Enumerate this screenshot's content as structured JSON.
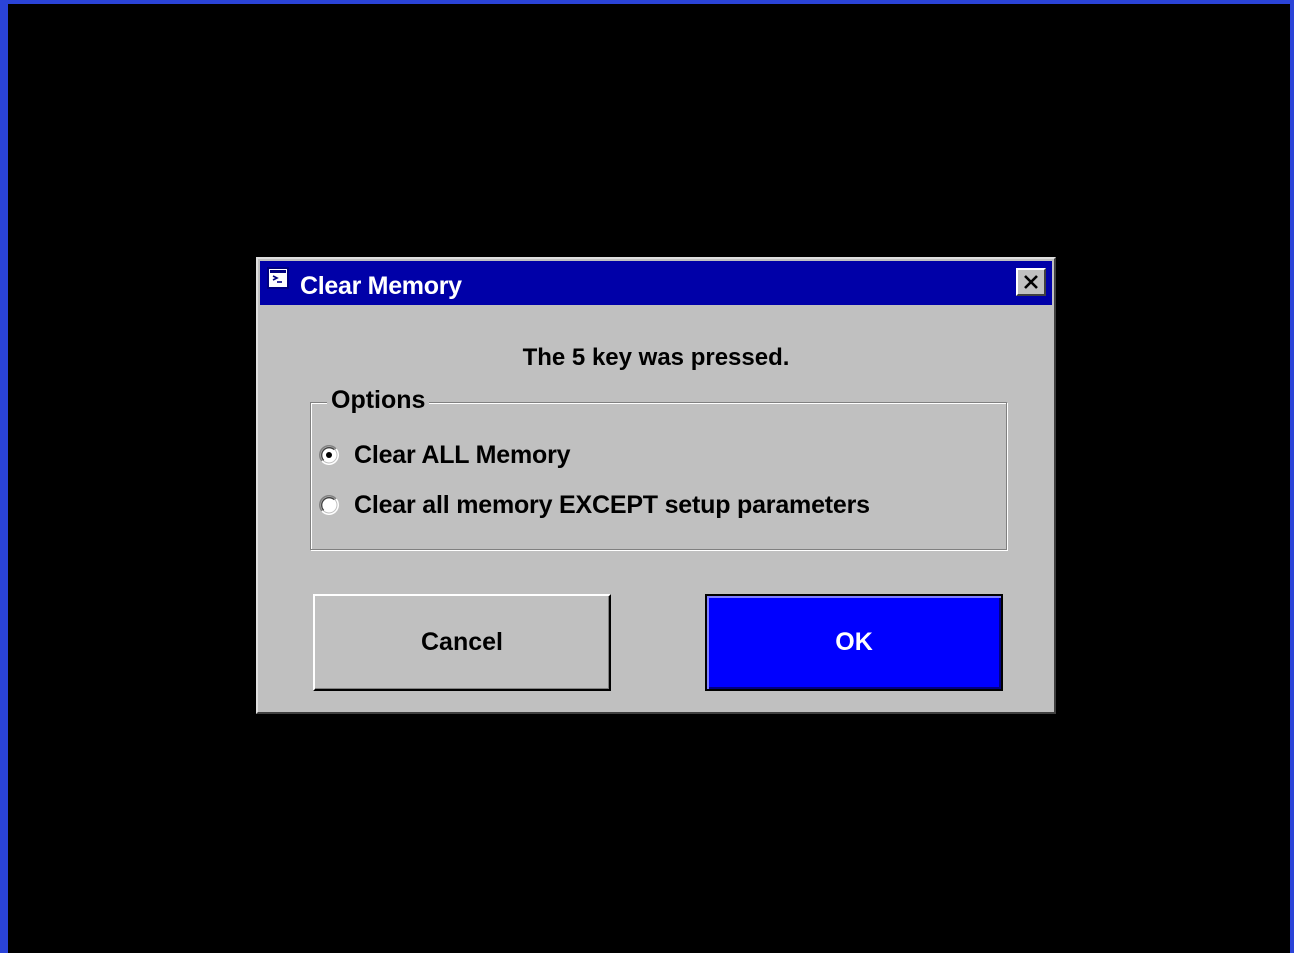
{
  "dialog": {
    "title": "Clear Memory",
    "message": "The 5 key was pressed."
  },
  "options": {
    "legend": "Options",
    "items": [
      {
        "label": "Clear ALL Memory",
        "selected": true
      },
      {
        "label": "Clear all memory EXCEPT setup parameters",
        "selected": false
      }
    ]
  },
  "buttons": {
    "cancel_label": "Cancel",
    "ok_label": "OK"
  },
  "colors": {
    "desktop": "#000000",
    "frame": "#2a43d8",
    "titlebar": "#0000a8",
    "dialog_face": "#c0c0c0",
    "ok_button": "#0000ff"
  },
  "icons": {
    "app": "app-window-icon",
    "close": "close-icon",
    "radio_selected": "radio-selected-icon",
    "radio_unselected": "radio-unselected-icon"
  }
}
